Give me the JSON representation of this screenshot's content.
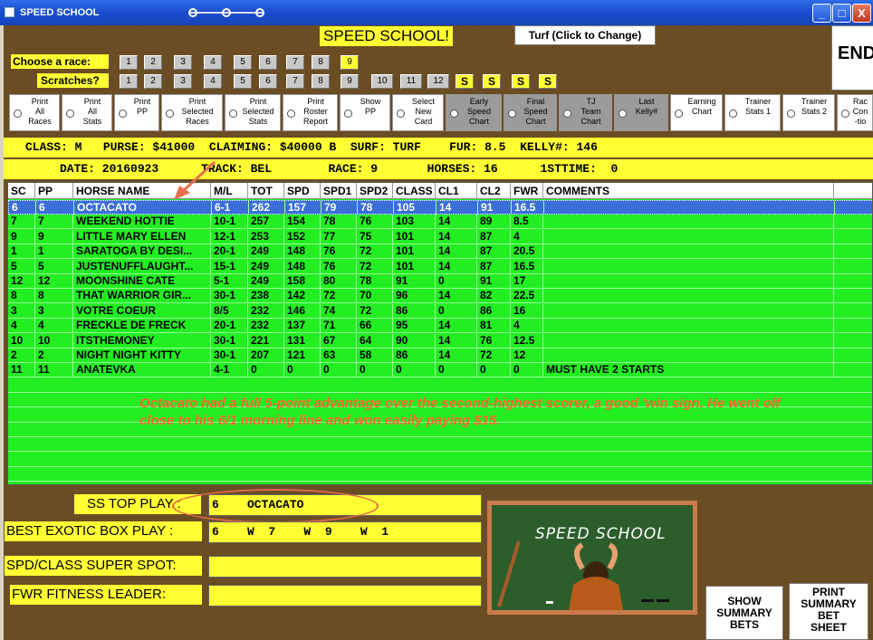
{
  "window": {
    "title": "SPEED SCHOOL",
    "controls": [
      "_",
      "□",
      "X"
    ]
  },
  "header": {
    "app_title": "SPEED SCHOOL!",
    "turf_button": "Turf (Click to Change)",
    "end_button": "END"
  },
  "race_selector": {
    "label": "Choose  a race:",
    "races": [
      "1",
      "2",
      "3",
      "4",
      "5",
      "6",
      "7",
      "8",
      "9"
    ],
    "selected": "9"
  },
  "scratches": {
    "label": "Scratches?",
    "numbers": [
      "1",
      "2",
      "3",
      "4",
      "5",
      "6",
      "7",
      "8",
      "9",
      "10",
      "11",
      "12"
    ],
    "specials": [
      "S",
      "S",
      "S",
      "S"
    ]
  },
  "print_options": [
    {
      "label": "Print\nAll\nRaces",
      "style": "white"
    },
    {
      "label": "Print\nAll\nStats",
      "style": "white"
    },
    {
      "label": "Print\nPP",
      "style": "white"
    },
    {
      "label": "Print\nSelected\nRaces",
      "style": "white"
    },
    {
      "label": "Print\nSelected\nStats",
      "style": "white"
    },
    {
      "label": "Print\nRoster\nReport",
      "style": "white"
    },
    {
      "label": "Show\nPP",
      "style": "white"
    },
    {
      "label": "Select\nNew\nCard",
      "style": "white"
    },
    {
      "label": "Early\nSpeed\nChart",
      "style": "dark"
    },
    {
      "label": "Final\nSpeed\nChart",
      "style": "dark"
    },
    {
      "label": "TJ\nTeam\nChart",
      "style": "dark"
    },
    {
      "label": "Last\nKelly#",
      "style": "dark"
    },
    {
      "label": "Earning\nChart",
      "style": "white"
    },
    {
      "label": "Trainer\nStats 1",
      "style": "white"
    },
    {
      "label": "Trainer\nStats 2",
      "style": "white"
    },
    {
      "label": "Rac\nCon\n-tio",
      "style": "white"
    }
  ],
  "race_info": {
    "line1": "CLASS: M   PURSE: $41000  CLAIMING: $40000 B  SURF: TURF    FUR: 8.5  KELLY#: 146",
    "line2": "DATE: 20160923      TRACK: BEL        RACE: 9       HORSES: 16      1STTIME:  0"
  },
  "table": {
    "columns": [
      "SC",
      "PP",
      "HORSE NAME",
      "M/L",
      "TOT",
      "SPD",
      "SPD1",
      "SPD2",
      "CLASS",
      "CL1",
      "CL2",
      "FWR",
      "COMMENTS"
    ],
    "rows": [
      [
        "6",
        "6",
        "OCTACATO",
        "6-1",
        "262",
        "157",
        "79",
        "78",
        "105",
        "14",
        "91",
        "16.5",
        ""
      ],
      [
        "7",
        "7",
        "WEEKEND HOTTIE",
        "10-1",
        "257",
        "154",
        "78",
        "76",
        "103",
        "14",
        "89",
        "8.5",
        ""
      ],
      [
        "9",
        "9",
        "LITTLE MARY ELLEN",
        "12-1",
        "253",
        "152",
        "77",
        "75",
        "101",
        "14",
        "87",
        "4",
        ""
      ],
      [
        "1",
        "1",
        "SARATOGA BY DESI...",
        "20-1",
        "249",
        "148",
        "76",
        "72",
        "101",
        "14",
        "87",
        "20.5",
        ""
      ],
      [
        "5",
        "5",
        "JUSTENUFFLAUGHT...",
        "15-1",
        "249",
        "148",
        "76",
        "72",
        "101",
        "14",
        "87",
        "16.5",
        ""
      ],
      [
        "12",
        "12",
        "MOONSHINE CATE",
        "5-1",
        "249",
        "158",
        "80",
        "78",
        "91",
        "0",
        "91",
        "17",
        ""
      ],
      [
        "8",
        "8",
        "THAT WARRIOR GIR...",
        "30-1",
        "238",
        "142",
        "72",
        "70",
        "96",
        "14",
        "82",
        "22.5",
        ""
      ],
      [
        "3",
        "3",
        "VOTRE COEUR",
        "8/5",
        "232",
        "146",
        "74",
        "72",
        "86",
        "0",
        "86",
        "16",
        ""
      ],
      [
        "4",
        "4",
        "FRECKLE DE FRECK",
        "20-1",
        "232",
        "137",
        "71",
        "66",
        "95",
        "14",
        "81",
        "4",
        ""
      ],
      [
        "10",
        "10",
        "ITSTHEMONEY",
        "30-1",
        "221",
        "131",
        "67",
        "64",
        "90",
        "14",
        "76",
        "12.5",
        ""
      ],
      [
        "2",
        "2",
        "NIGHT NIGHT KITTY",
        "30-1",
        "207",
        "121",
        "63",
        "58",
        "86",
        "14",
        "72",
        "12",
        ""
      ],
      [
        "11",
        "11",
        "ANATEVKA",
        "4-1",
        "0",
        "0",
        "0",
        "0",
        "0",
        "0",
        "0",
        "0",
        "MUST HAVE 2 STARTS"
      ]
    ],
    "selected_row": 0
  },
  "annotation": "Octacato had a full 5-point advantage over the second-highest scorer, a good 'win sign.  He went off close to his 6/1 morning line and won easily paying $15.",
  "plays": {
    "top_play_label": "SS TOP PLAY :",
    "top_play_value": "6    OCTACATO",
    "exotic_label": "BEST EXOTIC BOX PLAY :",
    "exotic_value": "6    W  7    W  9    W  1",
    "super_spot_label": "SPD/CLASS SUPER SPOT:",
    "super_spot_value": "",
    "fwr_label": "FWR FITNESS LEADER:",
    "fwr_value": ""
  },
  "chalkboard": {
    "text": "SPEED SCHOOL"
  },
  "buttons": {
    "show_summary": "SHOW\nSUMMARY\nBETS",
    "print_summary": "PRINT\nSUMMARY\nBET\nSHEET"
  }
}
